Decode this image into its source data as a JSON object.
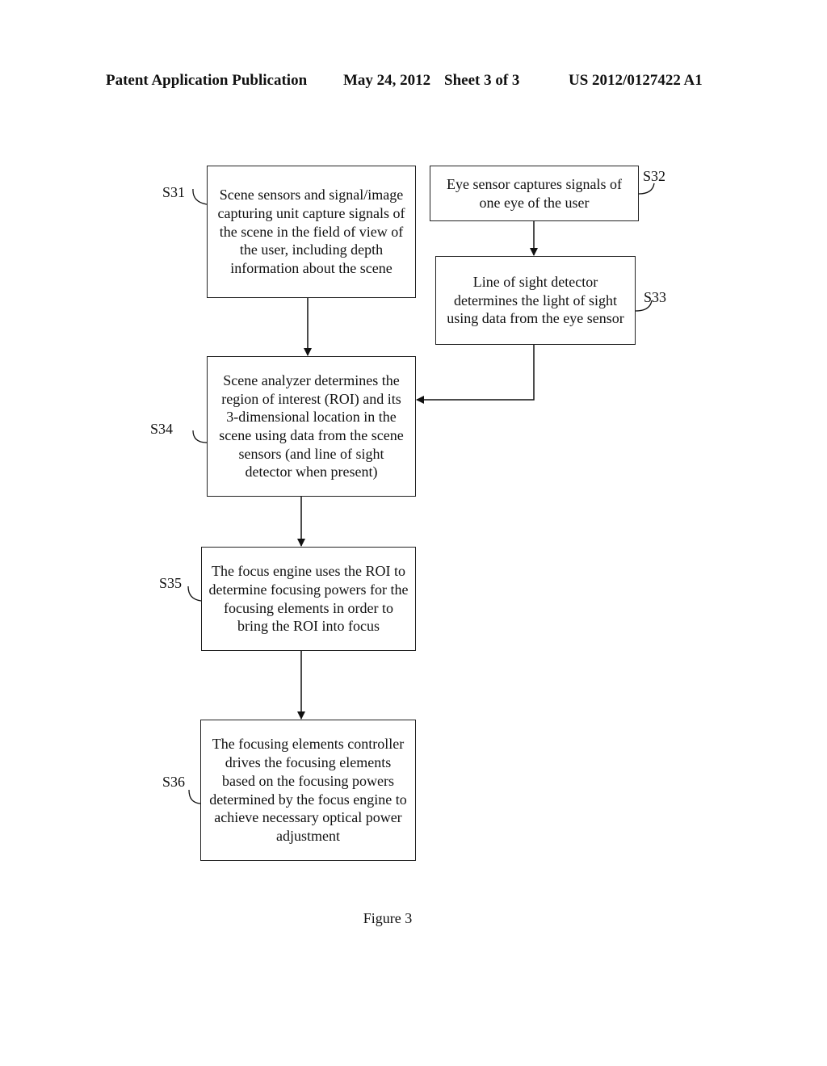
{
  "header": {
    "publication_type": "Patent Application Publication",
    "date": "May 24, 2012",
    "sheet": "Sheet 3 of 3",
    "patent_number": "US 2012/0127422 A1"
  },
  "flowchart": {
    "steps": [
      {
        "id": "S31",
        "label": "S31",
        "text": "Scene sensors and signal/image capturing unit capture signals of the scene in the field of view of the user, including depth information about the scene"
      },
      {
        "id": "S32",
        "label": "S32",
        "text": "Eye sensor captures signals of one eye of the user"
      },
      {
        "id": "S33",
        "label": "S33",
        "text": "Line of sight detector determines the light of sight using data from the eye sensor"
      },
      {
        "id": "S34",
        "label": "S34",
        "text": "Scene analyzer determines the region of interest (ROI) and its 3-dimensional location in the scene using data from the scene sensors (and line of sight detector when present)"
      },
      {
        "id": "S35",
        "label": "S35",
        "text": "The focus engine uses the ROI to determine focusing powers for the focusing elements in order to bring the ROI into focus"
      },
      {
        "id": "S36",
        "label": "S36",
        "text": "The focusing elements controller drives the focusing elements based on the focusing powers determined by the focus engine to achieve necessary optical power adjustment"
      }
    ],
    "edges": [
      {
        "from": "S31",
        "to": "S34"
      },
      {
        "from": "S32",
        "to": "S33"
      },
      {
        "from": "S33",
        "to": "S34"
      },
      {
        "from": "S34",
        "to": "S35"
      },
      {
        "from": "S35",
        "to": "S36"
      }
    ]
  },
  "caption": "Figure 3"
}
